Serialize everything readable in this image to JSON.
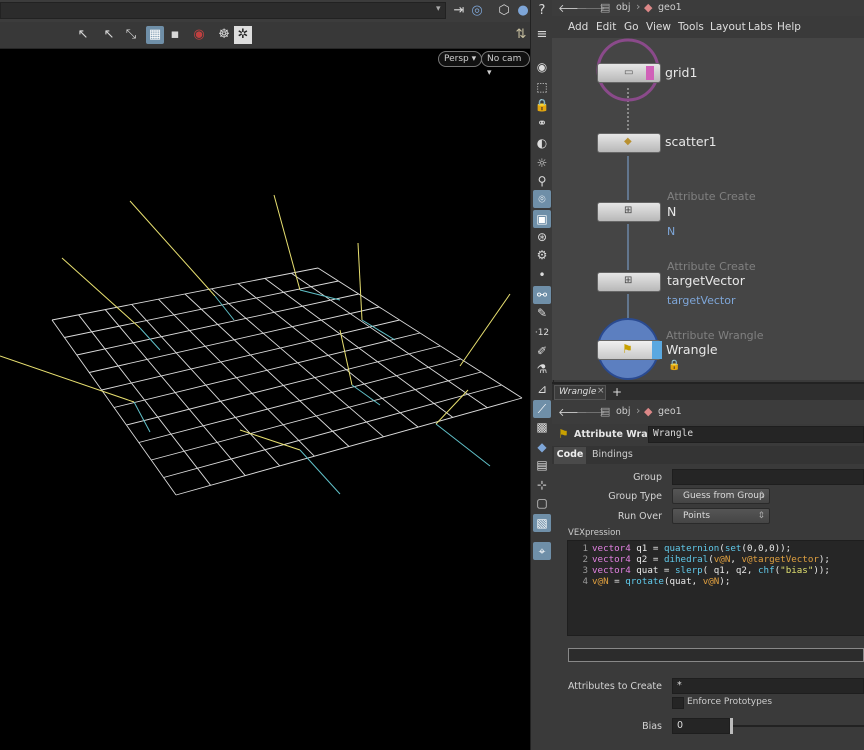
{
  "viewport": {
    "camera_persp": "Persp ▾",
    "camera_cam": "No cam ▾"
  },
  "network": {
    "path": [
      "obj",
      "geo1"
    ],
    "menu": [
      "Add",
      "Edit",
      "Go",
      "View",
      "Tools",
      "Layout",
      "Labs",
      "Help"
    ],
    "nodes": [
      {
        "type": "",
        "name": "grid1",
        "sub": ""
      },
      {
        "type": "",
        "name": "scatter1",
        "sub": ""
      },
      {
        "type": "Attribute Create",
        "name": "N",
        "sub": "N"
      },
      {
        "type": "Attribute Create",
        "name": "targetVector",
        "sub": "targetVector"
      },
      {
        "type": "Attribute Wrangle",
        "name": "Wrangle",
        "sub": ""
      }
    ]
  },
  "params": {
    "tab_label": "Wrangle",
    "add_tab": "+",
    "path": [
      "obj",
      "geo1"
    ],
    "node_type": "Attribute Wrangle",
    "node_name": "Wrangle",
    "subtabs": [
      "Code",
      "Bindings"
    ],
    "group_label": "Group",
    "group_value": "",
    "group_type_label": "Group Type",
    "group_type_value": "Guess from Group",
    "run_over_label": "Run Over",
    "run_over_value": "Points",
    "vex_label": "VEXpression",
    "code_lines": [
      {
        "n": "1",
        "text": "vector4 q1 = quaternion(set(0,0,0));"
      },
      {
        "n": "2",
        "text": "vector4 q2 = dihedral(v@N, v@targetVector);"
      },
      {
        "n": "3",
        "text": "vector4 quat = slerp( q1, q2, chf(\"bias\"));"
      },
      {
        "n": "4",
        "text": "v@N = qrotate(quat, v@N);"
      }
    ],
    "attr_create_label": "Attributes to Create",
    "attr_create_value": "*",
    "enforce_label": "Enforce Prototypes",
    "bias_label": "Bias",
    "bias_value": "0"
  },
  "colors": {
    "accent": "#6f8fa8",
    "node_link": "#7ea6d8",
    "grid_line": "#dcdcdc",
    "vec_yellow": "#e8e070",
    "vec_cyan": "#60c0c8"
  }
}
